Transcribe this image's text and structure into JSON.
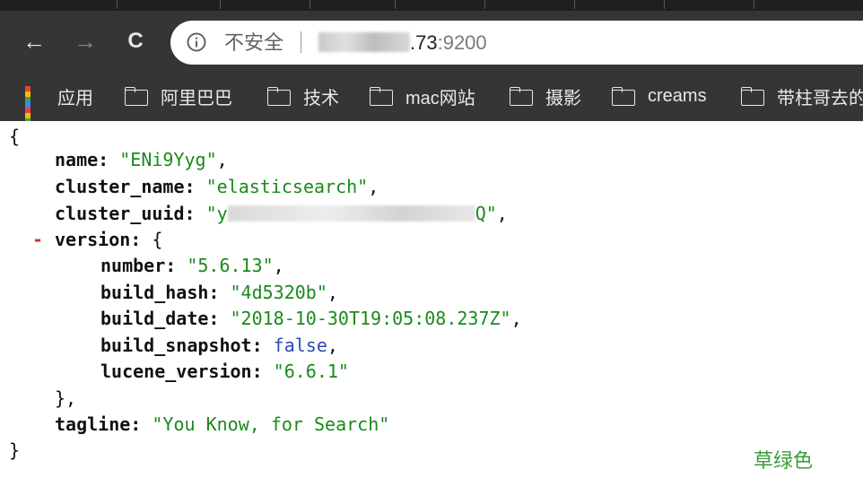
{
  "browser": {
    "nav": {
      "back_icon": "←",
      "forward_icon": "→",
      "reload_icon": "C"
    },
    "omnibox": {
      "security_label": "不安全",
      "url_visible": ".73",
      "url_port": ":9200"
    },
    "bookmarks": [
      {
        "label": "应用",
        "icon": "apps-grid-icon"
      },
      {
        "label": "阿里巴巴",
        "icon": "folder-icon"
      },
      {
        "label": "技术",
        "icon": "folder-icon"
      },
      {
        "label": "mac网站",
        "icon": "folder-icon"
      },
      {
        "label": "摄影",
        "icon": "folder-icon"
      },
      {
        "label": "creams",
        "icon": "folder-icon"
      },
      {
        "label": "带柱哥去的",
        "icon": "folder-icon"
      }
    ]
  },
  "json_view": {
    "open_brace": "{",
    "close_brace": "}",
    "name": {
      "key": "name",
      "value": "\"ENi9Yyg\""
    },
    "cluster_name": {
      "key": "cluster_name",
      "value": "\"elasticsearch\""
    },
    "cluster_uuid": {
      "key": "cluster_uuid",
      "value_start": "\"y",
      "value_end": "Q\""
    },
    "version": {
      "key": "version",
      "collapse_marker": "-",
      "open": "{",
      "close": "},",
      "number": {
        "key": "number",
        "value": "\"5.6.13\""
      },
      "build_hash": {
        "key": "build_hash",
        "value": "\"4d5320b\""
      },
      "build_date": {
        "key": "build_date",
        "value": "\"2018-10-30T19:05:08.237Z\""
      },
      "build_snapshot": {
        "key": "build_snapshot",
        "value": "false"
      },
      "lucene_version": {
        "key": "lucene_version",
        "value": "\"6.6.1\""
      }
    },
    "tagline": {
      "key": "tagline",
      "value": "\"You Know, for Search\""
    }
  },
  "watermark": "草绿色",
  "colors": {
    "string": "#1a8a1a",
    "boolean": "#2b4ab3",
    "collapse": "#d0342c",
    "toolbar_bg": "#353535"
  }
}
